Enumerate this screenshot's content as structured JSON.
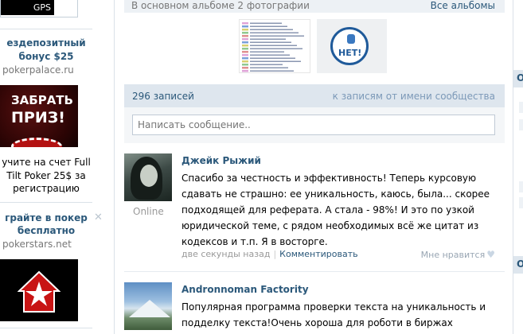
{
  "ads": {
    "top_button": "GPS",
    "ad1": {
      "title_line1": "езд​епозитный",
      "title_line2": "бонус $25",
      "domain": "pokerpalace.ru"
    },
    "ad2": {
      "image_line1": "ЗАБРАТЬ",
      "image_line2": "ПРИЗ!",
      "text_line1": "учите на счет Full",
      "text_line2": "Tilt Poker 25$ за",
      "text_line3": "регистрацию"
    },
    "ad3": {
      "title_line1": "грайте в покер",
      "title_line2": "бесплатно",
      "domain": "pokerstars.net",
      "close": "✕"
    }
  },
  "album": {
    "count_text": "В основном альбоме 2 фотографии",
    "all_link": "Все альбомы",
    "thumb2_text": "НЕТ!"
  },
  "wall": {
    "count": "296 записей",
    "community_link": "к записям от имени сообщества",
    "input_placeholder": "Написать сообщение.."
  },
  "posts": [
    {
      "author": "Джейк Рыжий",
      "status": "Online",
      "lines": [
        "Спасибо за честность и эффективность! Теперь курсовую",
        "сдавать не страшно: ее уникальность, каюсь, была... скорее",
        "подходящей для реферата. А стала - 98%! И это по узкой",
        "юридической теме, с рядом необходимых всё же цитат из",
        "кодексов и т.п. Я в восторге."
      ],
      "time": "две секунды назад",
      "comment": "Комментировать",
      "like": "Мне нравится"
    },
    {
      "author": "Andronnoman Factority",
      "lines": [
        "Популярная программа проверки текста на уникальность и",
        "подделку текста!Очень хороша для роботи в биржах"
      ]
    }
  ],
  "right": {
    "box1": "О",
    "box2": "О"
  },
  "colors": {
    "link": "#2b587a",
    "bar": "#dee6ee",
    "muted": "#777777"
  }
}
